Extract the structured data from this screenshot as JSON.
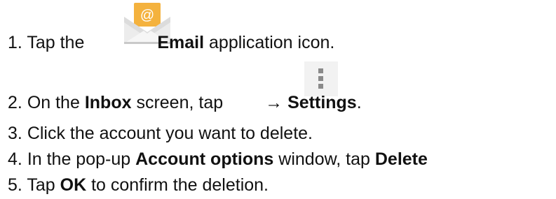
{
  "steps": [
    {
      "number": "1.",
      "parts": [
        "Tap the",
        "Email",
        "application icon."
      ],
      "icon": "email-app-icon"
    },
    {
      "number": "2.",
      "parts": [
        "On the",
        "Inbox",
        "screen, tap",
        "→",
        "Settings",
        "."
      ],
      "icon": "menu-overflow-icon"
    },
    {
      "number": "3.",
      "parts": [
        "Click the account you want to delete."
      ]
    },
    {
      "number": "4.",
      "parts": [
        "In the pop-up",
        "Account options",
        "window, tap",
        "Delete"
      ]
    },
    {
      "number": "5.",
      "parts": [
        "Tap",
        "OK",
        "to confirm the deletion."
      ]
    }
  ],
  "colors": {
    "envelope": "#e8e8e8",
    "envelope_shadow": "#c9c9c9",
    "letter_badge": "#f4b23e",
    "menu_dots": "#8a8a8a",
    "menu_bg": "#f2f2f2"
  }
}
